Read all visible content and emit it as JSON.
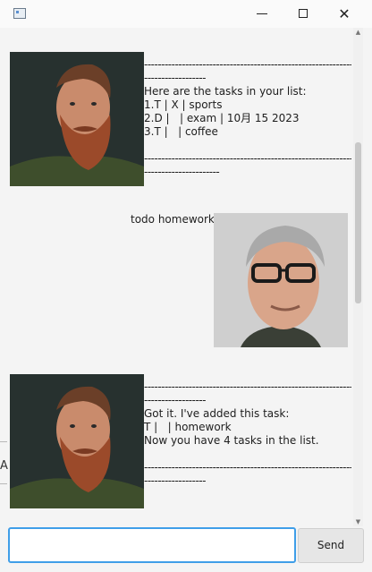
{
  "window": {
    "minimize_glyph": "",
    "maximize_glyph": "",
    "close_glyph": "✕"
  },
  "edge": {
    "cut_letter": "A"
  },
  "dialog": [
    {
      "sender": "duke",
      "avatar_icon": "bearded-man-portrait",
      "lines": [
        "-------------------------------------------------------------",
        "------------------",
        "Here are the tasks in your list:",
        "1.T | X | sports",
        "2.D |   | exam | 10月 15 2023",
        "3.T |   | coffee",
        "",
        "-------------------------------------------------------------",
        "----------------------"
      ]
    },
    {
      "sender": "user",
      "avatar_icon": "glasses-man-portrait",
      "lines": [
        "todo homework"
      ]
    },
    {
      "sender": "duke",
      "avatar_icon": "bearded-man-portrait",
      "lines": [
        "-------------------------------------------------------------",
        "------------------",
        "Got it. I've added this task:",
        "T |   | homework",
        "Now you have 4 tasks in the list.",
        "",
        "-------------------------------------------------------------",
        "------------------"
      ]
    }
  ],
  "input": {
    "value": "",
    "placeholder": ""
  },
  "send_button": {
    "label": "Send"
  },
  "colors": {
    "focus_border": "#3f9ee8",
    "background": "#f4f4f4"
  }
}
